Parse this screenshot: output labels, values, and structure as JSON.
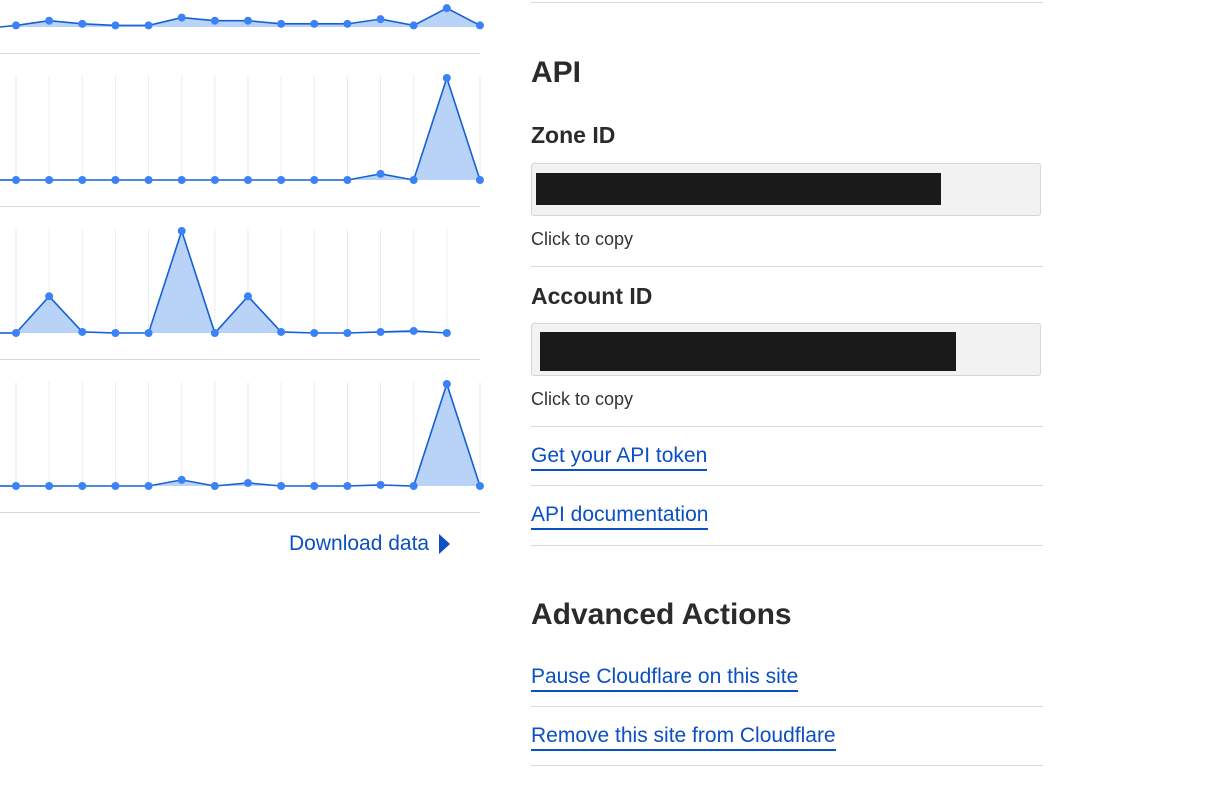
{
  "chart_data": [
    {
      "type": "area",
      "x": [
        0,
        1,
        2,
        3,
        4,
        5,
        6,
        7,
        8,
        9,
        10,
        11,
        12,
        13,
        14
      ],
      "values": [
        1,
        4,
        2,
        1,
        1,
        6,
        4,
        4,
        2,
        2,
        2,
        5,
        1,
        12,
        1
      ],
      "ylim": [
        0,
        14
      ]
    },
    {
      "type": "area",
      "x": [
        0,
        1,
        2,
        3,
        4,
        5,
        6,
        7,
        8,
        9,
        10,
        11,
        12,
        13,
        14
      ],
      "values": [
        0,
        0,
        0,
        0,
        0,
        0,
        0,
        0,
        0,
        0,
        0,
        6,
        0,
        100,
        0
      ],
      "ylim": [
        0,
        100
      ]
    },
    {
      "type": "area",
      "x": [
        0,
        1,
        2,
        3,
        4,
        5,
        6,
        7,
        8,
        9,
        10,
        11,
        12,
        13,
        14
      ],
      "values": [
        0,
        36,
        1,
        0,
        0,
        100,
        0,
        36,
        1,
        0,
        0,
        1,
        2,
        0
      ],
      "ylim": [
        0,
        100
      ]
    },
    {
      "type": "area",
      "x": [
        0,
        1,
        2,
        3,
        4,
        5,
        6,
        7,
        8,
        9,
        10,
        11,
        12,
        13,
        14
      ],
      "values": [
        0,
        0,
        0,
        0,
        0,
        6,
        0,
        3,
        0,
        0,
        0,
        1,
        0,
        100,
        0
      ],
      "ylim": [
        0,
        100
      ]
    }
  ],
  "download_label": "Download data",
  "api": {
    "heading": "API",
    "zone_id_label": "Zone ID",
    "account_id_label": "Account ID",
    "click_to_copy": "Click to copy",
    "token_link": "Get your API token",
    "docs_link": "API documentation"
  },
  "advanced": {
    "heading": "Advanced Actions",
    "pause_link": "Pause Cloudflare on this site",
    "remove_link": "Remove this site from Cloudflare"
  },
  "colors": {
    "accent": "#0a4fc4",
    "line": "#1560d4",
    "point": "#3b82f6",
    "fill": "#b9d3f8"
  }
}
